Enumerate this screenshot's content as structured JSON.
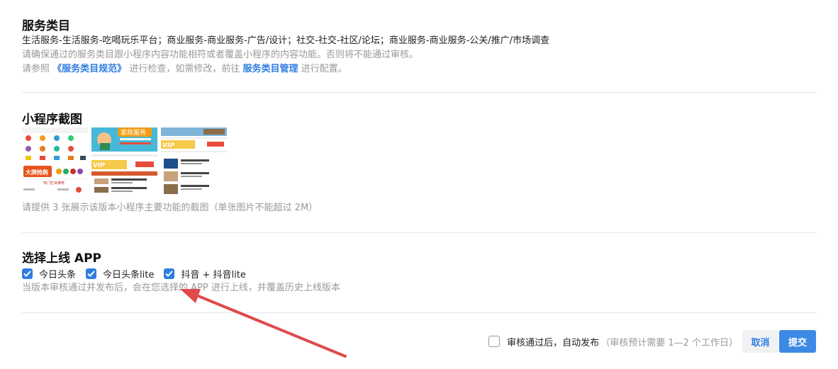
{
  "service": {
    "title": "服务类目",
    "categories": "生活服务-生活服务-吃喝玩乐平台；商业服务-商业服务-广告/设计；社交-社交-社区/论坛；商业服务-商业服务-公关/推广/市场调查",
    "note": "请确保通过的服务类目跟小程序内容功能相符或者覆盖小程序的内容功能。否则将不能通过审核。",
    "ref_prefix": "请参照",
    "ref_link": "《服务类目规范》",
    "ref_mid": "进行检查，如需修改，前往",
    "manage_link": "服务类目管理",
    "ref_suffix": "进行配置。"
  },
  "screenshots": {
    "title": "小程序截图",
    "hint": "请提供 3 张展示该版本小程序主要功能的截图（单张图片不能超过 2M）",
    "shot2_banner": "家政服务",
    "shot1_promo": "大牌抢购",
    "shot1_section": "热门栏目推荐",
    "vip_text": "VIP"
  },
  "apps": {
    "title": "选择上线 APP",
    "options": [
      {
        "label": "今日头条",
        "checked": true
      },
      {
        "label": "今日头条lite",
        "checked": true
      },
      {
        "label": "抖音 + 抖音lite",
        "checked": true
      }
    ],
    "hint": "当版本审核通过并发布后，会在您选择的 APP 进行上线，并覆盖历史上线版本"
  },
  "footer": {
    "auto_publish_label": "审核通过后，自动发布",
    "auto_publish_hint": "（审核预计需要 1—2 个工作日）",
    "auto_publish_checked": false,
    "cancel_label": "取消",
    "submit_label": "提交"
  },
  "colors": {
    "accent": "#2f7de1",
    "arrow": "#e04a4a"
  }
}
